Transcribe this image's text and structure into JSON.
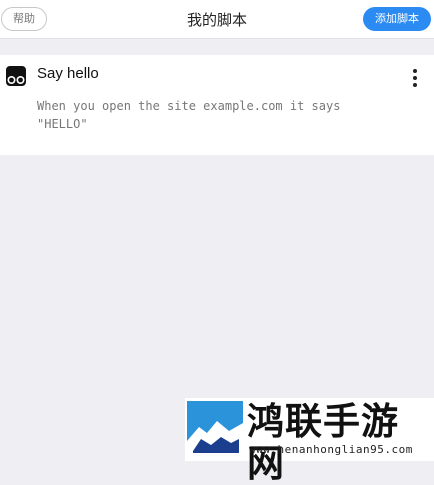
{
  "header": {
    "help_label": "帮助",
    "title": "我的脚本",
    "add_label": "添加脚本",
    "accent_color": "#2b8bf2"
  },
  "scripts": [
    {
      "title": "Say hello",
      "description": "When you open the site example.com it says\n\"HELLO\"",
      "icon": "script-icon",
      "menu_icon": "more-vertical-icon"
    }
  ],
  "watermark": {
    "text": "鸿联手游网",
    "url": "www.henanhonglian95.com"
  }
}
